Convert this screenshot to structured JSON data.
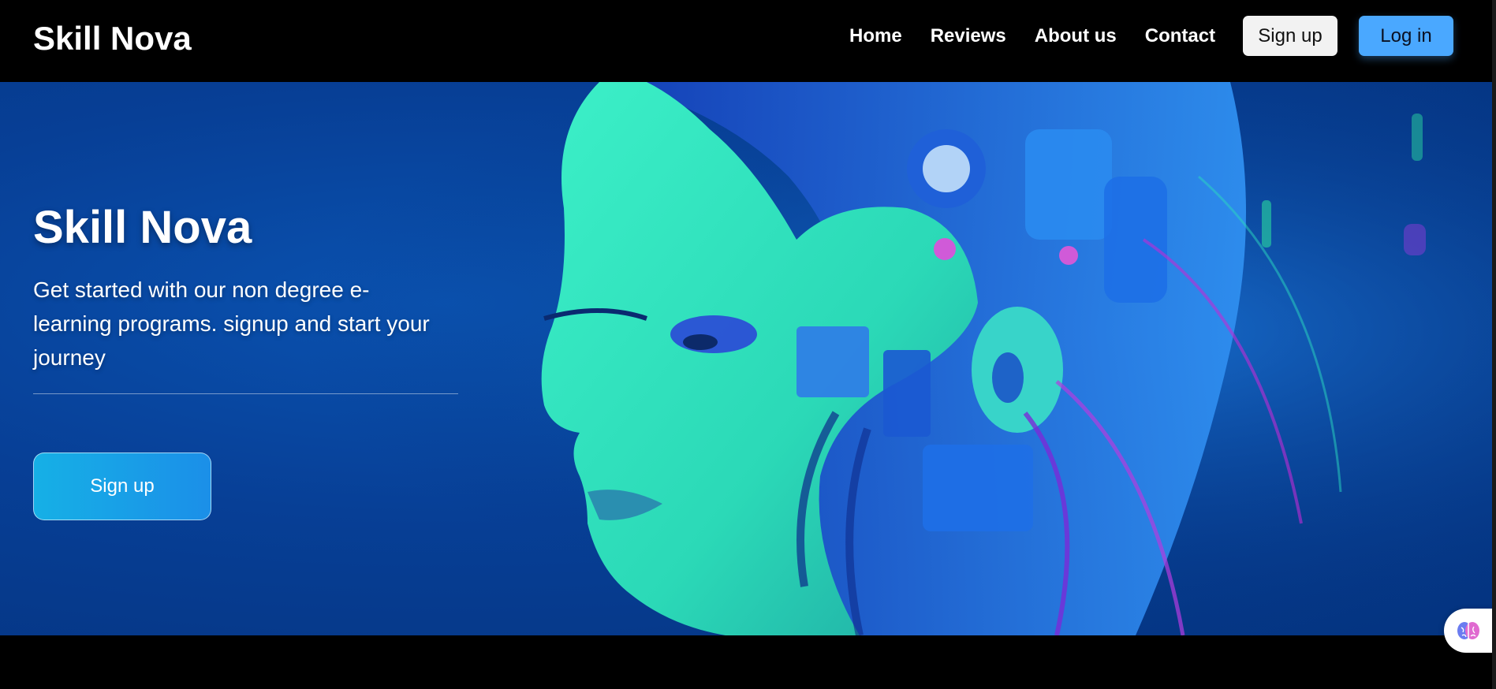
{
  "nav": {
    "brand": "Skill Nova",
    "links": [
      "Home",
      "Reviews",
      "About us",
      "Contact"
    ],
    "signup_label": "Sign up",
    "login_label": "Log in"
  },
  "hero": {
    "title": "Skill Nova",
    "subtitle": "Get started with our non degree e-learning programs. signup and start your journey",
    "cta_label": "Sign up",
    "image_subject": "cyborg-woman-illustration"
  },
  "widget": {
    "icon": "brain-icon"
  },
  "colors": {
    "hero_bg": "#073f96",
    "login_button": "#4aa8ff",
    "cta_start": "#16b0e6",
    "cta_end": "#1b8fe8",
    "face": "#2fe6bd"
  }
}
